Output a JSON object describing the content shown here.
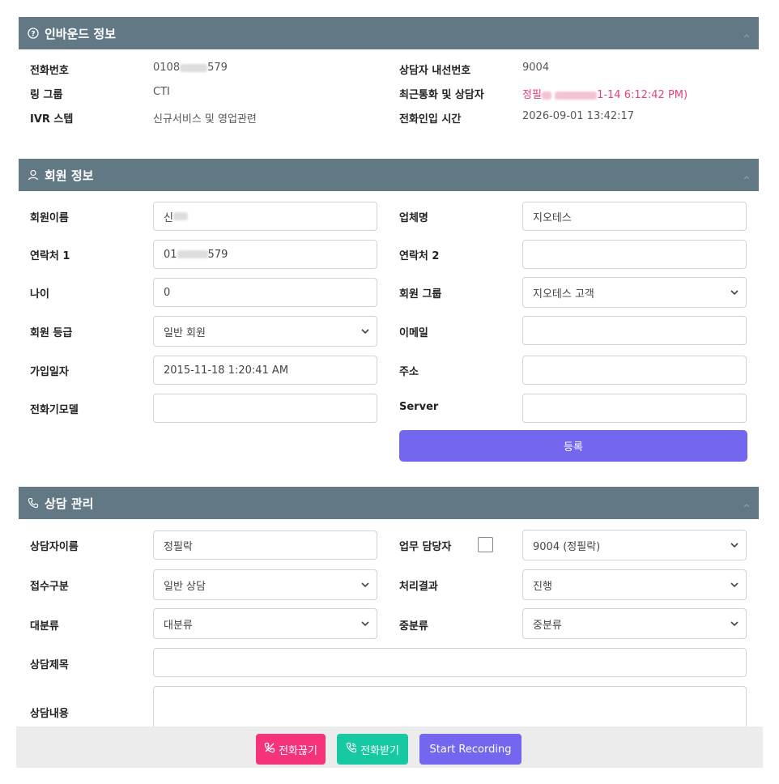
{
  "inbound": {
    "title": "인바운드 정보",
    "phone_label": "전화번호",
    "phone_prefix": "0108",
    "phone_suffix": "579",
    "ring_group_label": "링 그룹",
    "ring_group": "CTI",
    "ivr_label": "IVR 스텝",
    "ivr": "신규서비스 및 영업관련",
    "agent_ext_label": "상담자 내선번호",
    "agent_ext": "9004",
    "recent_label": "최근통화 및 상담자",
    "recent_prefix": "정필",
    "recent_suffix": "1-14 6:12:42 PM)",
    "inbound_time_label": "전화인입 시간",
    "inbound_time": "2026-09-01 13:42:17"
  },
  "member": {
    "title": "회원 정보",
    "name_label": "회원이름",
    "name_prefix": "신",
    "company_label": "업체명",
    "company": "지오테스",
    "contact1_label": "연락처 1",
    "contact1_prefix": "01",
    "contact1_suffix": "579",
    "contact2_label": "연락처 2",
    "contact2": "",
    "age_label": "나이",
    "age": "0",
    "group_label": "회원 그룹",
    "group": "지오테스 고객",
    "grade_label": "회원 등급",
    "grade": "일반 회원",
    "email_label": "이메일",
    "email": "",
    "join_label": "가입일자",
    "join_date": "2015-11-18 1:20:41 AM",
    "address_label": "주소",
    "address": "",
    "model_label": "전화기모델",
    "model": "",
    "server_label": "Server",
    "server": "",
    "register_button": "등록"
  },
  "consult": {
    "title": "상담 관리",
    "agent_name_label": "상담자이름",
    "agent_name": "정필락",
    "assignee_label": "업무 담당자",
    "assignee": "9004 (정필락)",
    "intake_label": "접수구분",
    "intake": "일반 상담",
    "result_label": "처리결과",
    "result": "진행",
    "major_label": "대분류",
    "major": "대분류",
    "minor_label": "중분류",
    "minor": "중분류",
    "subject_label": "상담제목",
    "subject": "",
    "content_label": "상담내용",
    "content": ""
  },
  "actions": {
    "hangup": "전화끊기",
    "answer": "전화받기",
    "record": "Start Recording"
  },
  "colors": {
    "header": "#627885",
    "accent": "#7367f0",
    "hangup": "#f5337a",
    "answer": "#17c9a3",
    "highlight": "#e8407a"
  }
}
